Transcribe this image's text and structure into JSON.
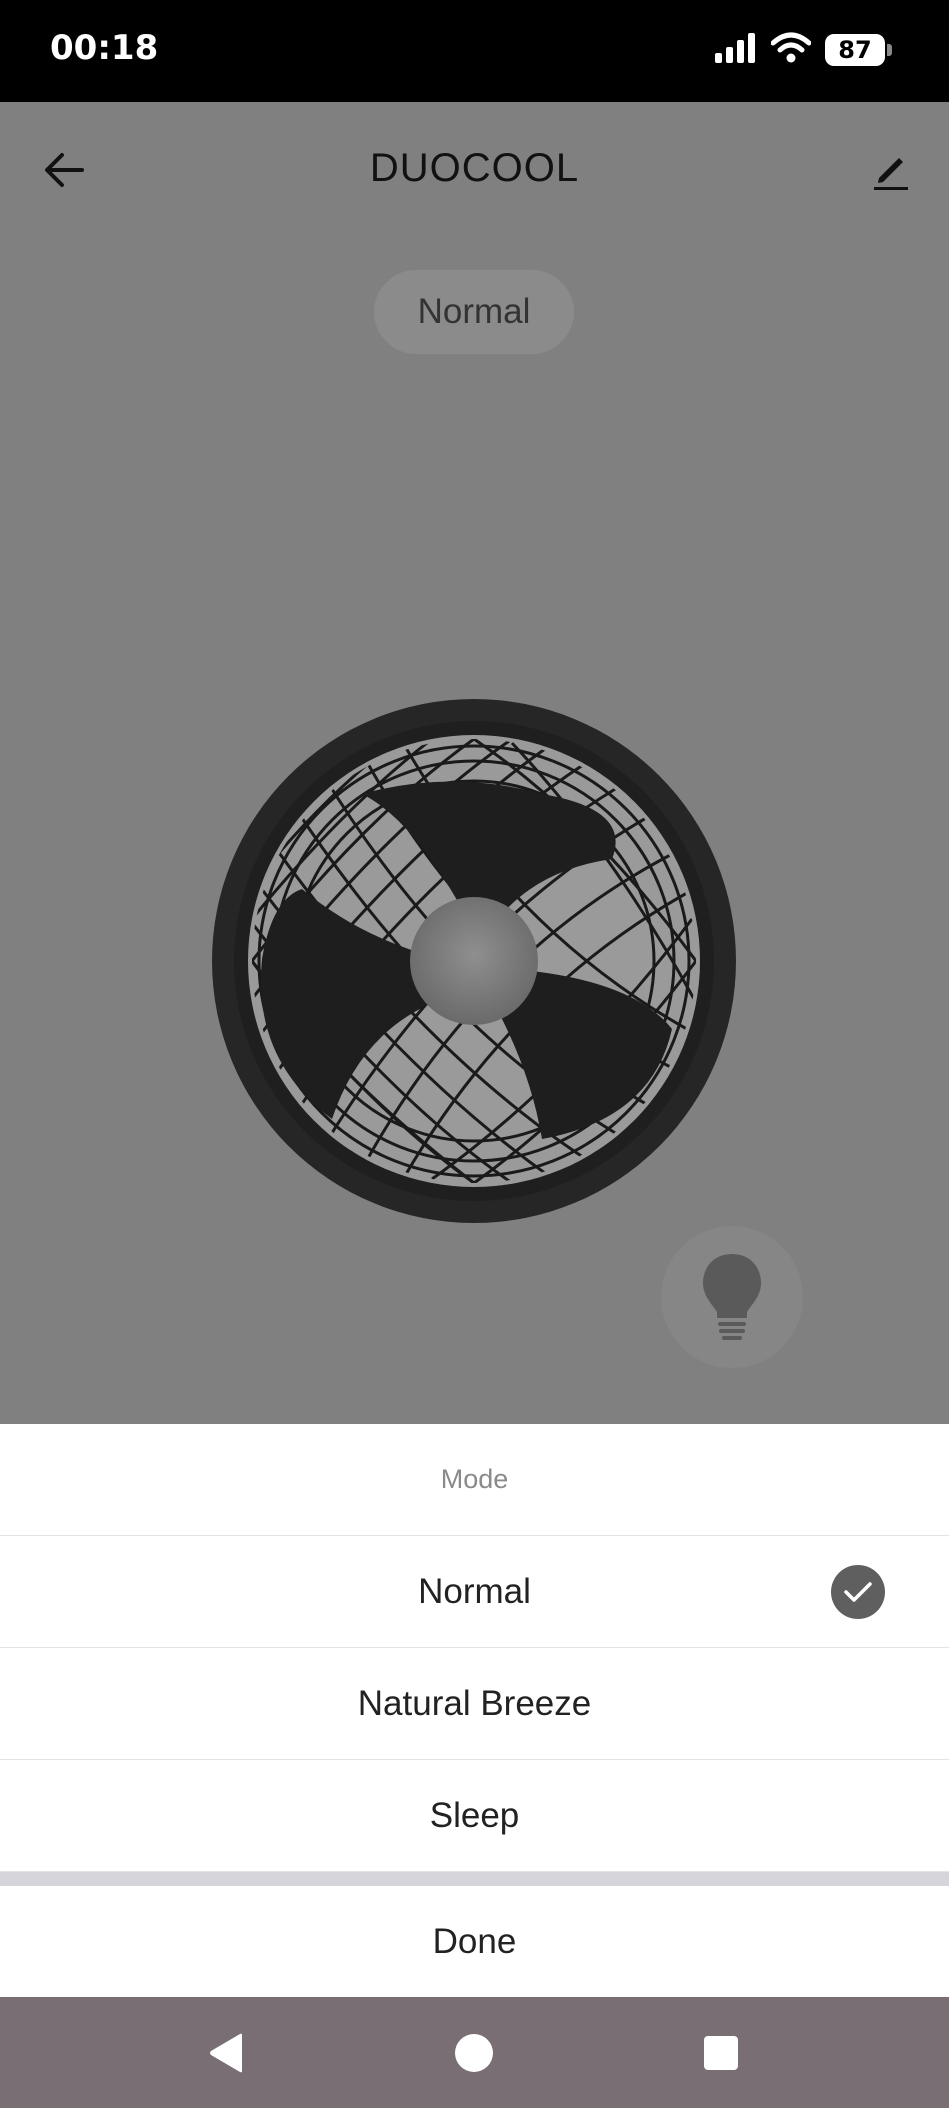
{
  "status_bar": {
    "time": "00:18",
    "battery": "87",
    "icons": [
      "signal-icon",
      "wifi-icon",
      "battery-icon"
    ]
  },
  "header": {
    "title": "DUOCOOL",
    "back_icon": "arrow-left-icon",
    "edit_icon": "pencil-icon"
  },
  "device": {
    "mode_chip": "Normal",
    "light_icon": "lightbulb-icon"
  },
  "mode_sheet": {
    "title": "Mode",
    "options": [
      {
        "label": "Normal",
        "selected": true
      },
      {
        "label": "Natural Breeze",
        "selected": false
      },
      {
        "label": "Sleep",
        "selected": false
      }
    ],
    "done_label": "Done"
  },
  "nav_bar": {
    "icons": [
      "nav-back-icon",
      "nav-home-icon",
      "nav-recents-icon"
    ]
  },
  "colors": {
    "overlay": "#808080",
    "sheet_bg": "#ffffff",
    "check_bg": "#5f5f5f",
    "nav_bg": "#7a6e75"
  }
}
